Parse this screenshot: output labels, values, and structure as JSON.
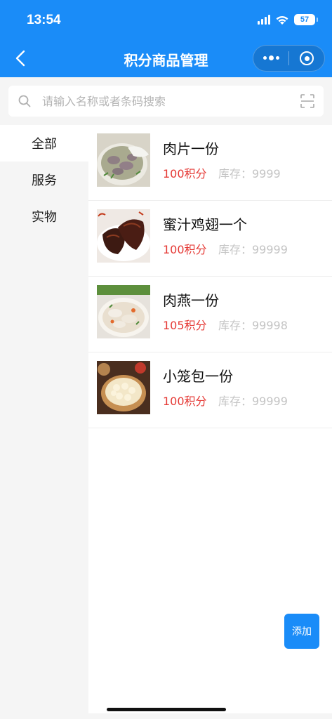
{
  "status_bar": {
    "time": "13:54",
    "battery": "57"
  },
  "nav": {
    "title": "积分商品管理"
  },
  "search": {
    "placeholder": "请输入名称或者条码搜索"
  },
  "sidebar": {
    "items": [
      {
        "label": "全部",
        "active": true
      },
      {
        "label": "服务",
        "active": false
      },
      {
        "label": "实物",
        "active": false
      }
    ]
  },
  "products": [
    {
      "name": "肉片一份",
      "points": "100积分",
      "stock": "库存：9999",
      "icon": "soup-bowl-photo"
    },
    {
      "name": "蜜汁鸡翅一个",
      "points": "100积分",
      "stock": "库存：99999",
      "icon": "chicken-wings-photo"
    },
    {
      "name": "肉燕一份",
      "points": "105积分",
      "stock": "库存：99998",
      "icon": "wonton-soup-photo"
    },
    {
      "name": "小笼包一份",
      "points": "100积分",
      "stock": "库存：99999",
      "icon": "dumpling-steamer-photo"
    }
  ],
  "actions": {
    "add_label": "添加"
  },
  "colors": {
    "primary": "#1a8cf8",
    "points": "#e53935",
    "stock": "#c4c4c4"
  }
}
